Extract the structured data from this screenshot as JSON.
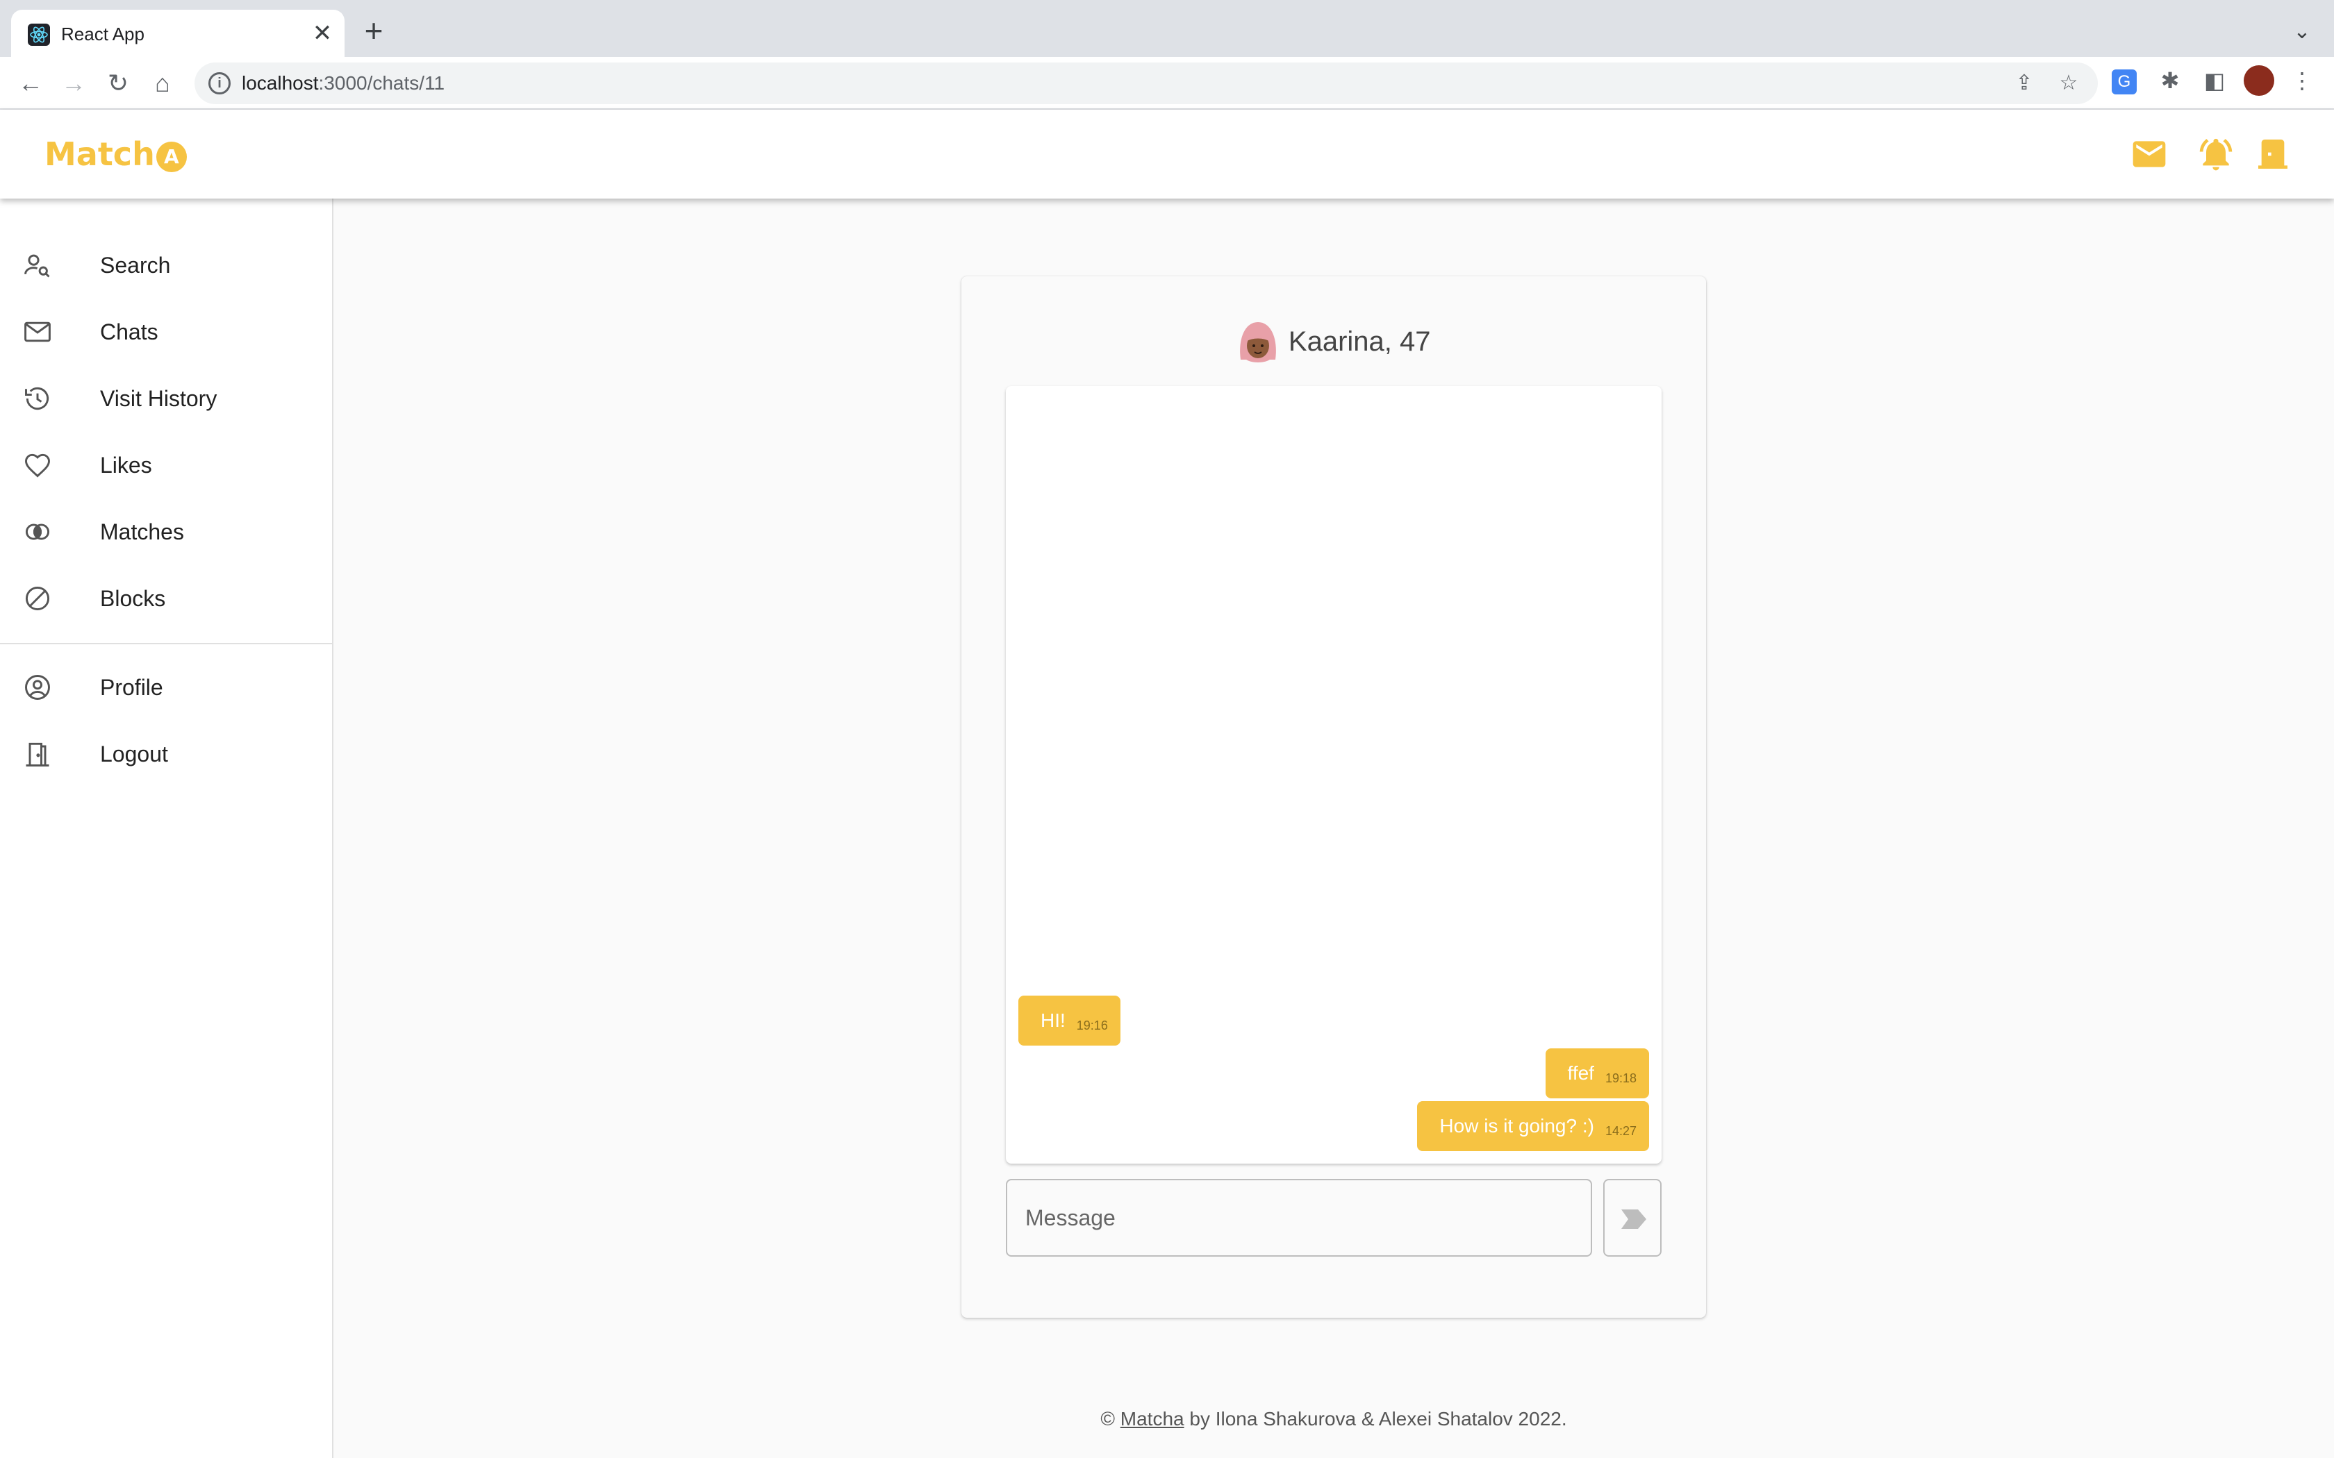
{
  "browser": {
    "tab_title": "React App",
    "tab_close": "✕",
    "new_tab": "+",
    "url_host": "localhost",
    "url_path": ":3000/chats/11"
  },
  "app": {
    "logo_text": "Match",
    "logo_badge": "A",
    "accent_color": "#f6c342"
  },
  "sidebar": {
    "items": [
      {
        "label": "Search",
        "icon": "person-search-icon"
      },
      {
        "label": "Chats",
        "icon": "mail-outline-icon"
      },
      {
        "label": "Visit History",
        "icon": "history-icon"
      },
      {
        "label": "Likes",
        "icon": "heart-outline-icon"
      },
      {
        "label": "Matches",
        "icon": "matches-icon"
      },
      {
        "label": "Blocks",
        "icon": "block-icon"
      }
    ],
    "secondary_items": [
      {
        "label": "Profile",
        "icon": "account-circle-icon"
      },
      {
        "label": "Logout",
        "icon": "door-icon"
      }
    ]
  },
  "chat": {
    "title": "Kaarina, 47",
    "messages": [
      {
        "text": "HI!",
        "time": "19:16",
        "side": "left"
      },
      {
        "text": "ffef",
        "time": "19:18",
        "side": "right"
      },
      {
        "text": "How is it going? :)",
        "time": "14:27",
        "side": "right"
      }
    ],
    "input_placeholder": "Message"
  },
  "footer": {
    "prefix": "©",
    "link_text": "Matcha",
    "suffix": "by Ilona Shakurova & Alexei Shatalov 2022."
  }
}
